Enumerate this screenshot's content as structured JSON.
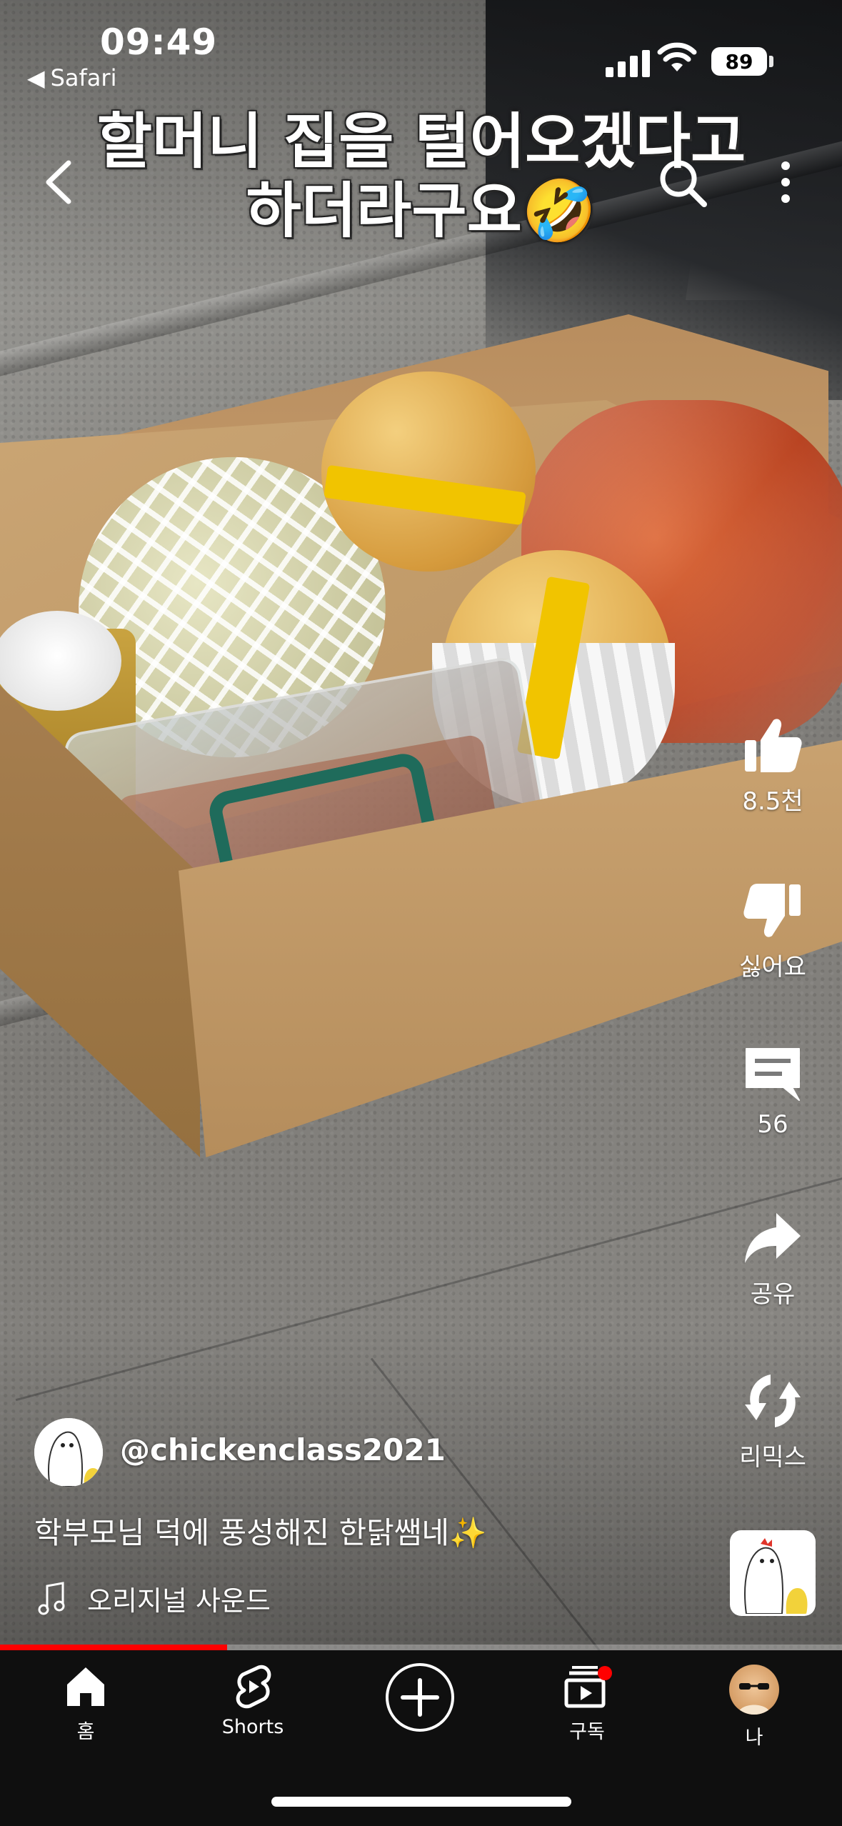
{
  "status_bar": {
    "time": "09:49",
    "back_app": "Safari",
    "battery": "89"
  },
  "overlay": {
    "caption_line1": "할머니 집을 털어오겠다고",
    "caption_line2": "하더라구요🤣"
  },
  "actions": {
    "like_count": "8.5천",
    "dislike_label": "싫어요",
    "comment_count": "56",
    "share_label": "공유",
    "remix_label": "리믹스"
  },
  "video_info": {
    "channel": "@chickenclass2021",
    "description": "학부모님 덕에 풍성해진 한닭쌤네✨",
    "sound": "오리지널 사운드",
    "progress_percent": 27
  },
  "tabbar": {
    "home": "홈",
    "shorts": "Shorts",
    "subscriptions": "구독",
    "me": "나"
  },
  "colors": {
    "accent": "#ff0000",
    "background": "#0f0f0f"
  },
  "icons": [
    "back-icon",
    "search-icon",
    "more-vertical-icon",
    "thumbs-up-icon",
    "thumbs-down-icon",
    "comment-icon",
    "share-icon",
    "remix-icon",
    "music-note-icon",
    "home-icon",
    "shorts-icon",
    "plus-icon",
    "subscriptions-icon"
  ]
}
